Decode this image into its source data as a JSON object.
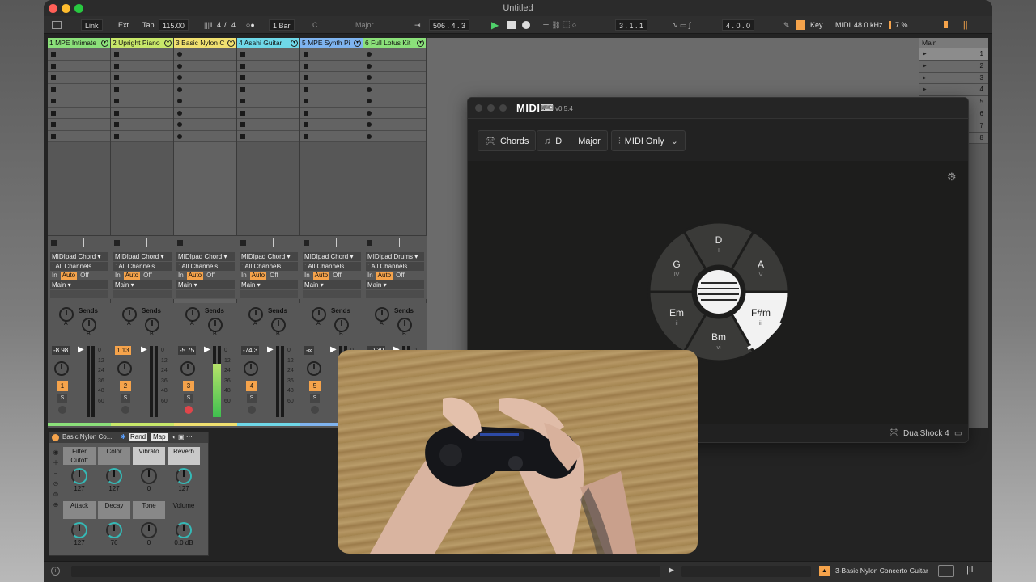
{
  "window": {
    "title": "Untitled"
  },
  "control_bar": {
    "link": "Link",
    "ext": "Ext",
    "tap": "Tap",
    "tempo": "115.00",
    "time_sig_num": "4",
    "time_sig_sep": "/",
    "time_sig_den": "4",
    "quantize": "1 Bar",
    "key_root": "C",
    "key_scale": "Major",
    "arrangement_position": "506 .  4 .  3",
    "loop_start": "3 .  1 .  1",
    "loop_length": "4 .  0 .  0",
    "key_label": "Key",
    "midi_label": "MIDI",
    "sample_rate": "48.0 kHz",
    "cpu": "7 %"
  },
  "tracks": [
    {
      "name": "1 MPE Intimate",
      "color": "#8be07a",
      "device": "MIDIpad Chord",
      "channels": "All Channels",
      "monitor_in": "In",
      "monitor_auto": "Auto",
      "monitor_off": "Off",
      "output": "Main",
      "sends": "Sends",
      "send_a": "A",
      "send_b": "B",
      "volume": "-8.98",
      "number": "1",
      "solo": "S"
    },
    {
      "name": "2 Upright Piano",
      "color": "#c8e86a",
      "device": "MIDIpad Chord",
      "channels": "All Channels",
      "monitor_in": "In",
      "monitor_auto": "Auto",
      "monitor_off": "Off",
      "output": "Main",
      "sends": "Sends",
      "send_a": "A",
      "send_b": "B",
      "volume": "1.13",
      "number": "2",
      "solo": "S"
    },
    {
      "name": "3 Basic Nylon C",
      "color": "#f0e070",
      "device": "MIDIpad Chord",
      "channels": "All Channels",
      "monitor_in": "In",
      "monitor_auto": "Auto",
      "monitor_off": "Off",
      "output": "Main",
      "sends": "Sends",
      "send_a": "A",
      "send_b": "B",
      "volume": "-5.75",
      "number": "3",
      "solo": "S"
    },
    {
      "name": "4 Asahi Guitar",
      "color": "#6fd8e8",
      "device": "MIDIpad Chord",
      "channels": "All Channels",
      "monitor_in": "In",
      "monitor_auto": "Auto",
      "monitor_off": "Off",
      "output": "Main",
      "sends": "Sends",
      "send_a": "A",
      "send_b": "B",
      "volume": "-74.3",
      "number": "4",
      "solo": "S"
    },
    {
      "name": "5 MPE Synth Pi",
      "color": "#7fb4f0",
      "device": "MIDIpad Chord",
      "channels": "All Channels",
      "monitor_in": "In",
      "monitor_auto": "Auto",
      "monitor_off": "Off",
      "output": "Main",
      "sends": "Sends",
      "send_a": "A",
      "send_b": "B",
      "volume": "-∞",
      "number": "5",
      "solo": "S"
    },
    {
      "name": "6 Full Lotus Kit",
      "color": "#8be07a",
      "device": "MIDIpad Drums",
      "channels": "All Channels",
      "monitor_in": "In",
      "monitor_auto": "Auto",
      "monitor_off": "Off",
      "output": "Main",
      "sends": "Sends",
      "send_a": "A",
      "send_b": "B",
      "volume": "-0.30",
      "number": "6",
      "solo": "S"
    }
  ],
  "meter_scale": [
    "0",
    "12",
    "24",
    "36",
    "48",
    "60"
  ],
  "master": {
    "name": "Main",
    "scenes": [
      "1",
      "2",
      "3",
      "4",
      "5",
      "6",
      "7",
      "8"
    ]
  },
  "device": {
    "name": "Basic Nylon Co...",
    "rand": "Rand",
    "map": "Map",
    "macros": [
      {
        "label": "Filter Cutoff",
        "value": "127"
      },
      {
        "label": "Color",
        "value": "127"
      },
      {
        "label": "Vibrato",
        "value": "0"
      },
      {
        "label": "Reverb",
        "value": "127"
      },
      {
        "label": "Attack",
        "value": "127"
      },
      {
        "label": "Decay",
        "value": "76"
      },
      {
        "label": "Tone",
        "value": "0"
      },
      {
        "label": "Volume",
        "value": "0.0 dB"
      }
    ]
  },
  "status": {
    "selected_track": "3-Basic Nylon Concerto Guitar"
  },
  "midipad": {
    "logo": "MIDI",
    "version": "v0.5.4",
    "mode": "Chords",
    "key": "D",
    "scale": "Major",
    "output": "MIDI Only",
    "controller": "DualShock 4",
    "wheel": [
      {
        "chord": "D",
        "degree": "I"
      },
      {
        "chord": "A",
        "degree": "V"
      },
      {
        "chord": "F#m",
        "degree": "iii"
      },
      {
        "chord": "Bm",
        "degree": "vi"
      },
      {
        "chord": "Em",
        "degree": "ii"
      },
      {
        "chord": "G",
        "degree": "IV"
      }
    ],
    "active_chord": "F#m"
  }
}
